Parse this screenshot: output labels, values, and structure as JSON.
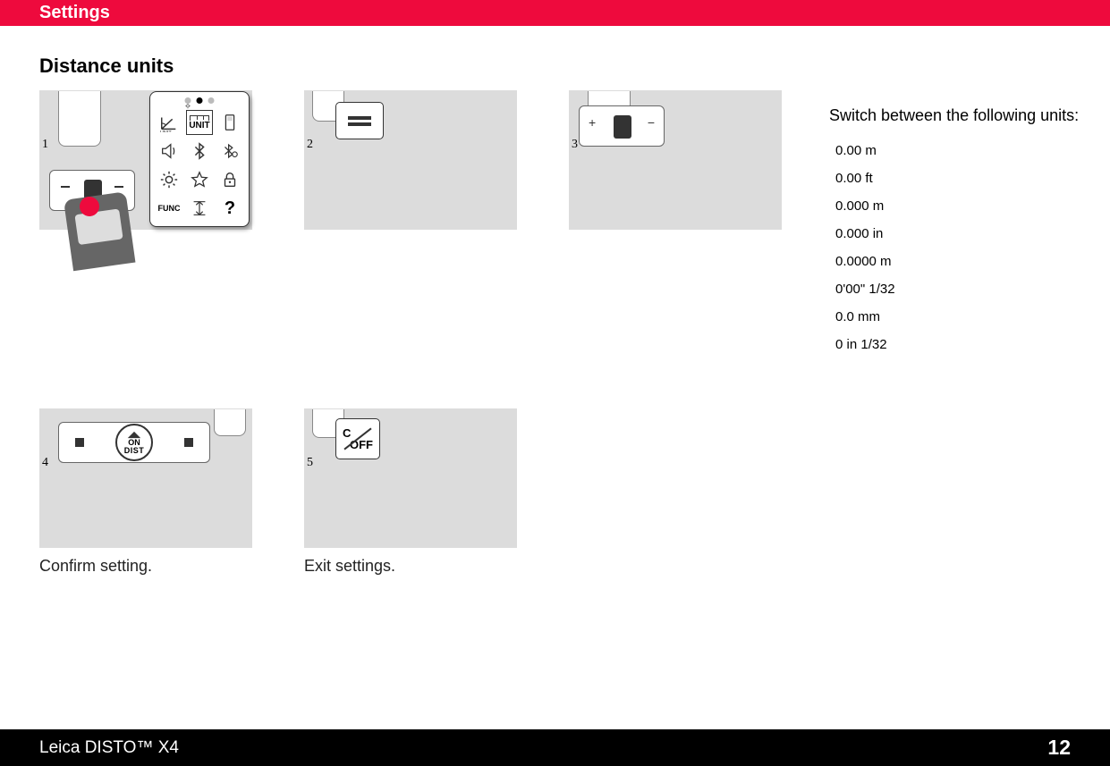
{
  "header": {
    "title": "Settings"
  },
  "section": {
    "heading": "Distance units"
  },
  "steps": {
    "s1": {
      "num": "1"
    },
    "s2": {
      "num": "2"
    },
    "s3": {
      "num": "3"
    },
    "s4": {
      "num": "4",
      "caption": "Confirm setting.",
      "btn_on": "ON",
      "btn_dist": "DIST"
    },
    "s5": {
      "num": "5",
      "caption": "Exit settings.",
      "btn_c": "C",
      "btn_off": "OFF"
    }
  },
  "units": {
    "heading": "Switch between the following units:",
    "list": [
      "0.00 m",
      "0.00 ft",
      "0.000 m",
      "0.000 in",
      "0.0000 m",
      "0'00\" 1/32",
      "0.0 mm",
      "0 in 1/32"
    ]
  },
  "icons": {
    "unit_label": "UNIT",
    "func_label": "FUNC"
  },
  "footer": {
    "product": "Leica DISTO™ X4",
    "page": "12"
  }
}
